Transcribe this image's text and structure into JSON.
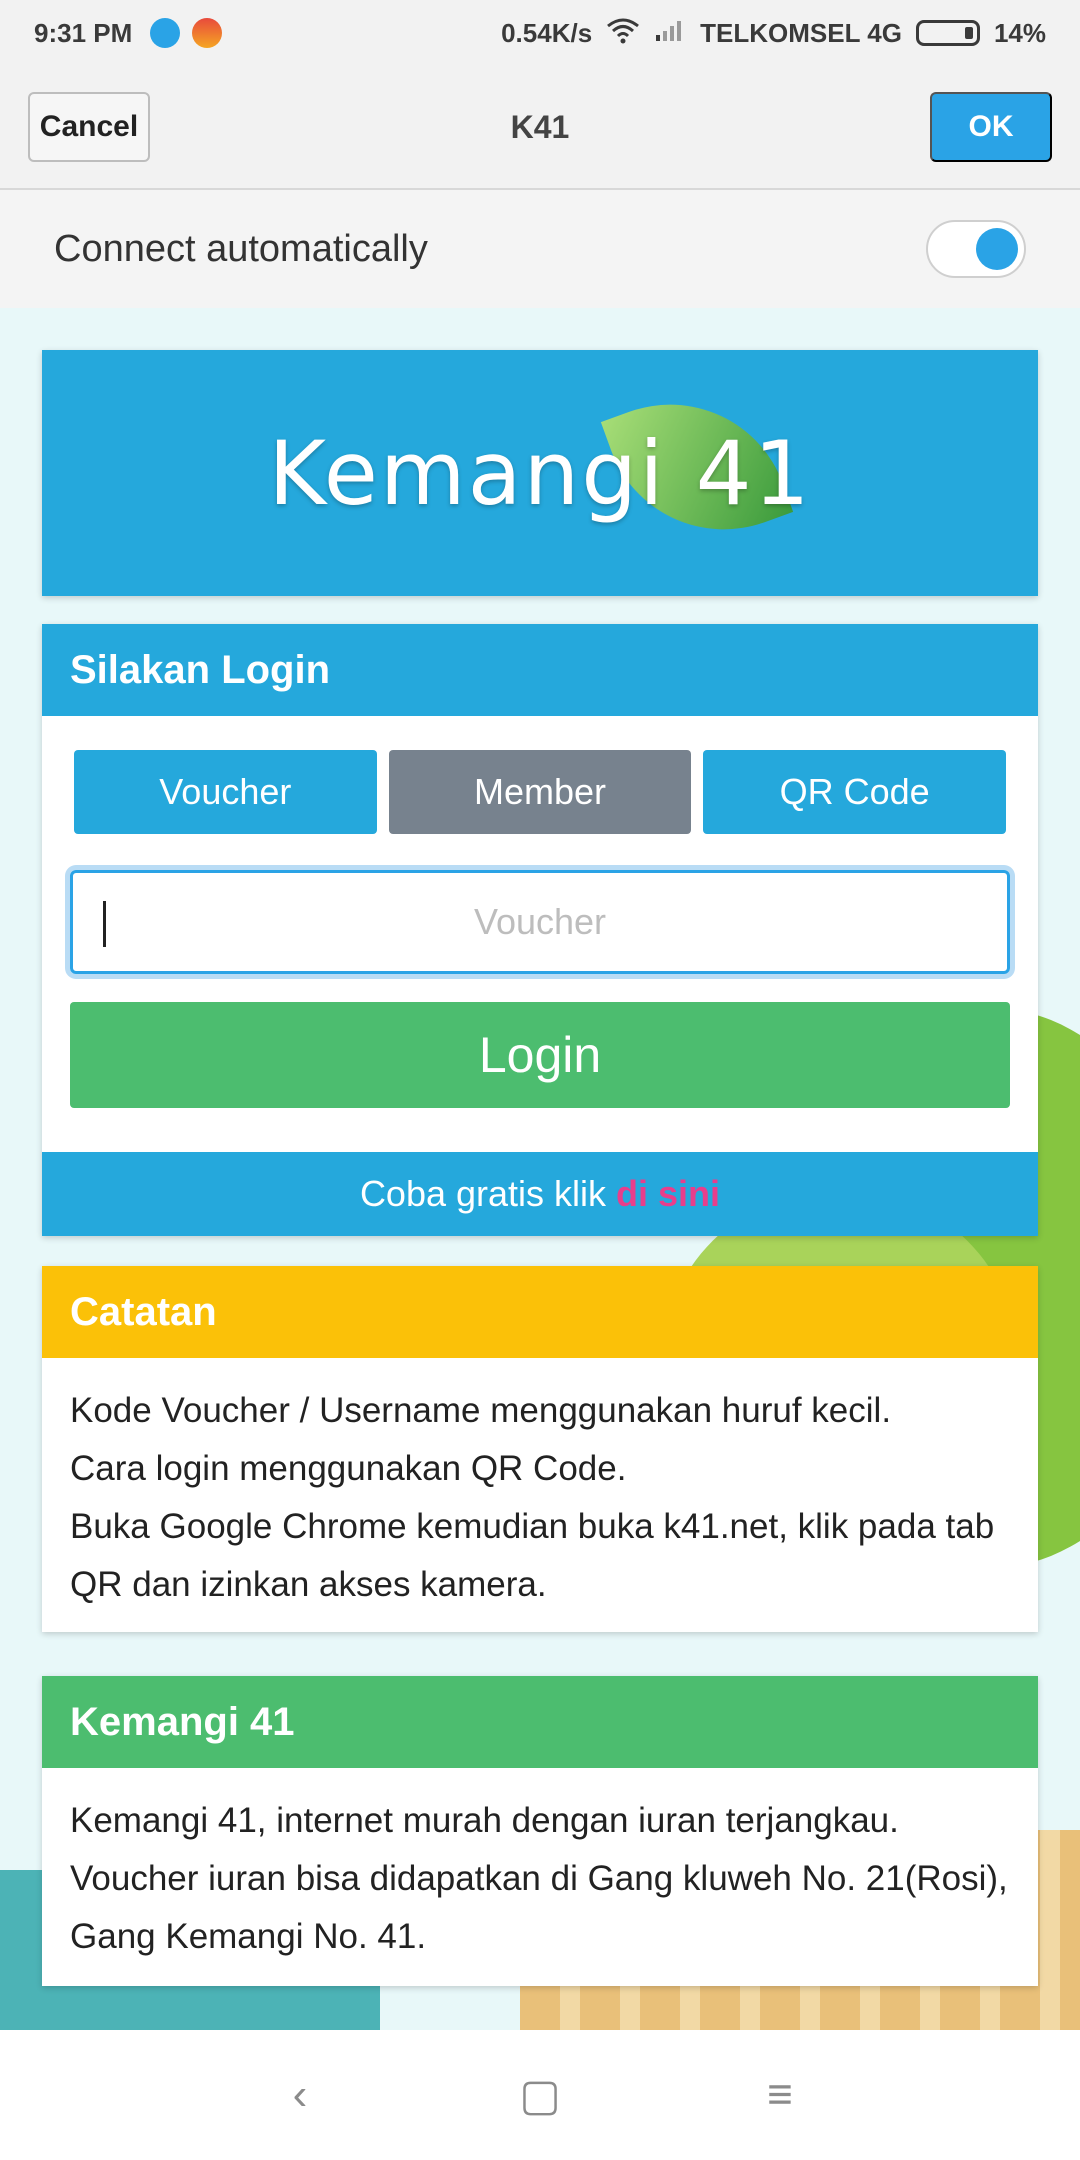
{
  "status_bar": {
    "time": "9:31 PM",
    "net_speed": "0.54K/s",
    "carrier": "TELKOMSEL 4G",
    "battery": "14%",
    "icons": [
      "wifi-app-icon",
      "app-notification-icon",
      "wifi-icon",
      "signal-icon",
      "battery-icon"
    ]
  },
  "title_bar": {
    "cancel_label": "Cancel",
    "title": "K41",
    "ok_label": "OK"
  },
  "connect": {
    "label": "Connect automatically",
    "enabled": true
  },
  "portal": {
    "logo_text": "Kemangi 41",
    "login": {
      "heading": "Silakan Login",
      "tabs": [
        {
          "label": "Voucher",
          "active": false
        },
        {
          "label": "Member",
          "active": true
        },
        {
          "label": "QR Code",
          "active": false
        }
      ],
      "input_placeholder": "Voucher",
      "input_value": "",
      "button_label": "Login",
      "trial_text": "Coba gratis klik",
      "trial_link": "di sini"
    },
    "notes": {
      "heading": "Catatan",
      "lines": [
        "Kode Voucher / Username menggunakan huruf kecil.",
        "Cara login menggunakan QR Code.",
        "Buka Google Chrome kemudian buka k41.net, klik pada tab QR dan izinkan akses kamera."
      ]
    },
    "info": {
      "heading": "Kemangi 41",
      "text": "Kemangi 41, internet murah dengan iuran terjangkau. Voucher iuran bisa didapatkan di Gang kluweh No. 21(Rosi), Gang Kemangi No. 41."
    }
  },
  "nav_bar": {
    "back_glyph": "‹",
    "home_glyph": "▢",
    "menu_glyph": "≡"
  },
  "colors": {
    "accent_blue": "#25a8dc",
    "green": "#4cbd6f",
    "yellow": "#fbc108",
    "gray_tab": "#77828e",
    "link_pink": "#e83e8c"
  }
}
